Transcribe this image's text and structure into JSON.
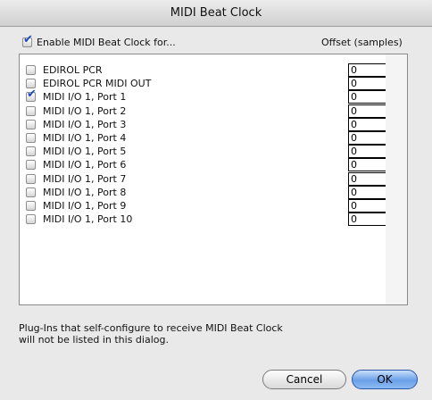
{
  "window": {
    "title": "MIDI Beat Clock"
  },
  "header": {
    "enable_label": "Enable MIDI Beat Clock for...",
    "enable_checked": true,
    "offset_label": "Offset (samples)"
  },
  "devices": [
    {
      "name": "EDIROL PCR",
      "checked": false,
      "offset": "0"
    },
    {
      "name": "EDIROL PCR MIDI OUT",
      "checked": false,
      "offset": "0"
    },
    {
      "name": "MIDI I/O 1, Port 1",
      "checked": true,
      "offset": "0"
    },
    {
      "name": "MIDI I/O 1, Port 2",
      "checked": false,
      "offset": "0"
    },
    {
      "name": "MIDI I/O 1, Port 3",
      "checked": false,
      "offset": "0"
    },
    {
      "name": "MIDI I/O 1, Port 4",
      "checked": false,
      "offset": "0"
    },
    {
      "name": "MIDI I/O 1, Port 5",
      "checked": false,
      "offset": "0"
    },
    {
      "name": "MIDI I/O 1, Port 6",
      "checked": false,
      "offset": "0"
    },
    {
      "name": "MIDI I/O 1, Port 7",
      "checked": false,
      "offset": "0"
    },
    {
      "name": "MIDI I/O 1, Port 8",
      "checked": false,
      "offset": "0"
    },
    {
      "name": "MIDI I/O 1, Port 9",
      "checked": false,
      "offset": "0"
    },
    {
      "name": "MIDI I/O 1, Port 10",
      "checked": false,
      "offset": "0"
    }
  ],
  "footer": {
    "note_line1": "Plug-Ins that self-configure to receive MIDI Beat Clock",
    "note_line2": "will not be listed in this dialog.",
    "cancel_label": "Cancel",
    "ok_label": "OK"
  },
  "colors": {
    "check_mark": "#1a46c8",
    "default_button": "#6aa0e8"
  }
}
